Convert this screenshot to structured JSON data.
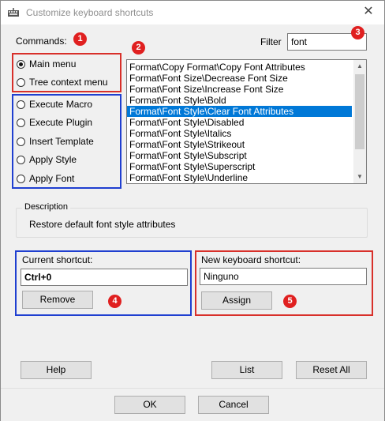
{
  "window": {
    "title": "Customize keyboard shortcuts",
    "close_glyph": "✕"
  },
  "commands": {
    "label": "Commands:",
    "group1": [
      {
        "label": "Main menu",
        "checked": true
      },
      {
        "label": "Tree context menu",
        "checked": false
      }
    ],
    "group2": [
      {
        "label": "Execute Macro",
        "checked": false
      },
      {
        "label": "Execute Plugin",
        "checked": false
      },
      {
        "label": "Insert Template",
        "checked": false
      },
      {
        "label": "Apply Style",
        "checked": false
      },
      {
        "label": "Apply Font",
        "checked": false
      }
    ]
  },
  "filter": {
    "label": "Filter",
    "value": "font"
  },
  "list": {
    "items": [
      "Format\\Copy Format\\Copy Font Attributes",
      "Format\\Font Size\\Decrease Font Size",
      "Format\\Font Size\\Increase Font Size",
      "Format\\Font Style\\Bold",
      "Format\\Font Style\\Clear Font Attributes",
      "Format\\Font Style\\Disabled",
      "Format\\Font Style\\Italics",
      "Format\\Font Style\\Strikeout",
      "Format\\Font Style\\Subscript",
      "Format\\Font Style\\Superscript",
      "Format\\Font Style\\Underline"
    ],
    "selected_index": 4
  },
  "description": {
    "label": "Description",
    "text": "Restore default font style attributes"
  },
  "current_shortcut": {
    "label": "Current shortcut:",
    "value": "Ctrl+0",
    "remove_label": "Remove"
  },
  "new_shortcut": {
    "label": "New keyboard shortcut:",
    "value": "Ninguno",
    "assign_label": "Assign"
  },
  "buttons": {
    "help": "Help",
    "list": "List",
    "reset_all": "Reset All",
    "ok": "OK",
    "cancel": "Cancel"
  },
  "badges": [
    "1",
    "2",
    "3",
    "4",
    "5"
  ],
  "colors": {
    "selection": "#0078d7",
    "red_box": "#d8302a",
    "blue_box": "#1f3fd0",
    "badge": "#e02020"
  }
}
